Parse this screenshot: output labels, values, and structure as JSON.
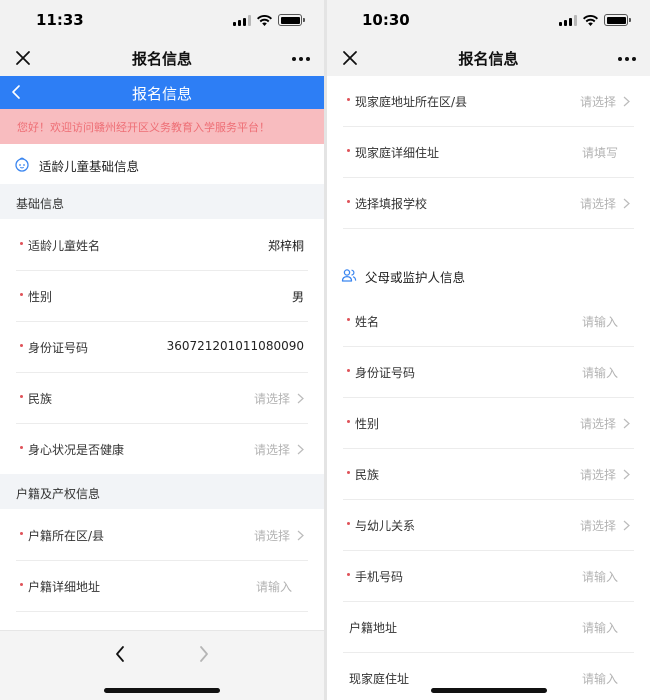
{
  "left": {
    "time": "11:33",
    "nav_title": "报名信息",
    "blue_title": "报名信息",
    "notice": "您好！欢迎访问赣州经开区义务教育入学服务平台！",
    "section_title": "适龄儿童基础信息",
    "group1": "基础信息",
    "rows": [
      {
        "label": "适龄儿童姓名",
        "value": "郑梓桐"
      },
      {
        "label": "性别",
        "value": "男"
      },
      {
        "label": "身份证号码",
        "value": "360721201011080090"
      },
      {
        "label": "民族",
        "placeholder": "请选择"
      },
      {
        "label": "身心状况是否健康",
        "placeholder": "请选择"
      }
    ],
    "group2": "户籍及产权信息",
    "rows2": [
      {
        "label": "户籍所在区/县",
        "placeholder": "请选择"
      },
      {
        "label": "户籍详细地址",
        "placeholder": "请输入"
      }
    ]
  },
  "right": {
    "time": "10:30",
    "nav_title": "报名信息",
    "rows_top": [
      {
        "label": "现家庭地址所在区/县",
        "placeholder": "请选择"
      },
      {
        "label": "现家庭详细住址",
        "placeholder": "请填写"
      },
      {
        "label": "选择填报学校",
        "placeholder": "请选择"
      }
    ],
    "section_title": "父母或监护人信息",
    "rows": [
      {
        "label": "姓名",
        "placeholder": "请输入"
      },
      {
        "label": "身份证号码",
        "placeholder": "请输入"
      },
      {
        "label": "性别",
        "placeholder": "请选择"
      },
      {
        "label": "民族",
        "placeholder": "请选择"
      },
      {
        "label": "与幼儿关系",
        "placeholder": "请选择"
      },
      {
        "label": "手机号码",
        "placeholder": "请输入"
      },
      {
        "label": "户籍地址",
        "placeholder": "请输入"
      },
      {
        "label": "现家庭住址",
        "placeholder": "请输入"
      }
    ]
  },
  "colors": {
    "brand_blue": "#2d7ef5",
    "notice_bg": "#f8bcbf",
    "notice_text": "#ee6e75",
    "required_dot": "#e0535a"
  },
  "icons": [
    "close-icon",
    "more-icon",
    "back-icon",
    "child-icon",
    "people-icon",
    "chevron-right-icon"
  ]
}
